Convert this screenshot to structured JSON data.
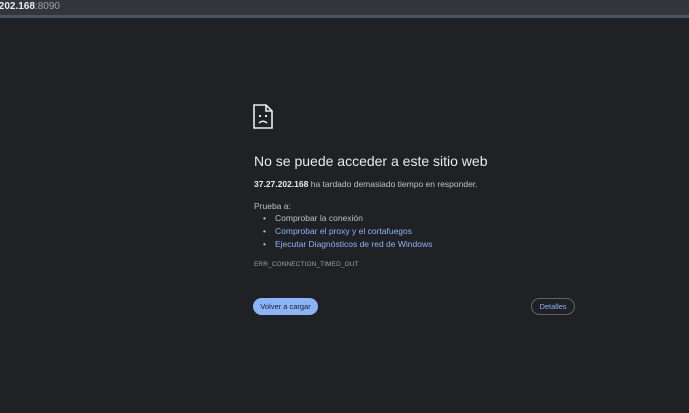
{
  "url": {
    "host_fragment": ".202.168",
    "port": ":8090"
  },
  "icon": {
    "name": "sad-page-icon",
    "color": "#e8eaed"
  },
  "error_page": {
    "title": "No se puede acceder a este sitio web",
    "summary_ip": "37.27.202.168",
    "summary_text": " ha tardado demasiado tiempo en responder.",
    "try_label": "Prueba a:",
    "suggestions": [
      {
        "text": "Comprobar la conexión",
        "is_link": false
      },
      {
        "text": "Comprobar el proxy y el cortafuegos",
        "is_link": true
      },
      {
        "text": "Ejecutar Diagnósticos de red de Windows",
        "is_link": true
      }
    ],
    "error_code": "ERR_CONNECTION_TIMED_OUT",
    "reload_label": "Volver a cargar",
    "details_label": "Detalles"
  },
  "colors": {
    "background": "#202124",
    "link": "#8ab4f8",
    "text_primary": "#e8eaed",
    "text_secondary": "#bdc1c6"
  }
}
